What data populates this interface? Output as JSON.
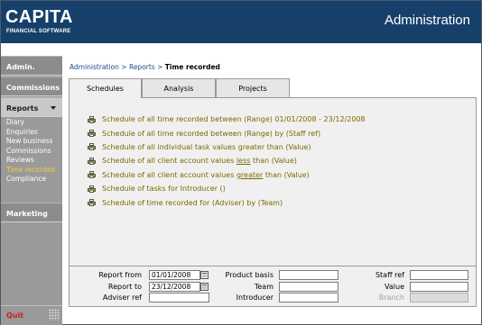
{
  "header": {
    "logo_main": "CAPITA",
    "logo_sub": "FINANCIAL SOFTWARE",
    "title": "Administration"
  },
  "sidebar": {
    "sections": {
      "admin": "Admin.",
      "commissions": "Commissions",
      "reports": "Reports",
      "marketing": "Marketing"
    },
    "reports_items": [
      "Diary",
      "Enquiries",
      "New business",
      "Commissions",
      "Reviews",
      "Time recorded",
      "Compliance"
    ],
    "current_item": "Time recorded",
    "quit": "Quit"
  },
  "breadcrumb": {
    "part1": "Administration",
    "sep": " > ",
    "part2": "Reports",
    "current": "Time recorded"
  },
  "tabs": [
    "Schedules",
    "Analysis",
    "Projects"
  ],
  "active_tab": "Schedules",
  "reports": [
    {
      "text": "Schedule of all time recorded between (Range) 01/01/2008 - 23/12/2008"
    },
    {
      "text": "Schedule of all time recorded  between (Range)  by (Staff ref)"
    },
    {
      "text": "Schedule of all individual task values greater than (Value)"
    },
    {
      "pre": "Schedule of all client account values ",
      "u": "less",
      "post": " than (Value)"
    },
    {
      "pre": "Schedule of all client account values ",
      "u": "greater",
      "post": " than (Value)"
    },
    {
      "text": "Schedule of tasks for Introducer ()"
    },
    {
      "text": "Schedule of time recorded for (Adviser)  by (Team)"
    }
  ],
  "filters": {
    "report_from_label": "Report from",
    "report_from_value": "01/01/2008",
    "report_to_label": "Report to",
    "report_to_value": "23/12/2008",
    "adviser_ref_label": "Adviser ref",
    "adviser_ref_value": "",
    "product_basis_label": "Product basis",
    "product_basis_value": "",
    "team_label": "Team",
    "team_value": "",
    "introducer_label": "Introducer",
    "introducer_value": "",
    "staff_ref_label": "Staff ref",
    "staff_ref_value": "",
    "value_label": "Value",
    "value_value": "",
    "branch_label": "Branch",
    "branch_value": ""
  },
  "colors": {
    "header_bg": "#16406a",
    "report_link": "#7a6a00",
    "current_nav": "#f0d040",
    "quit": "#cc2020"
  }
}
